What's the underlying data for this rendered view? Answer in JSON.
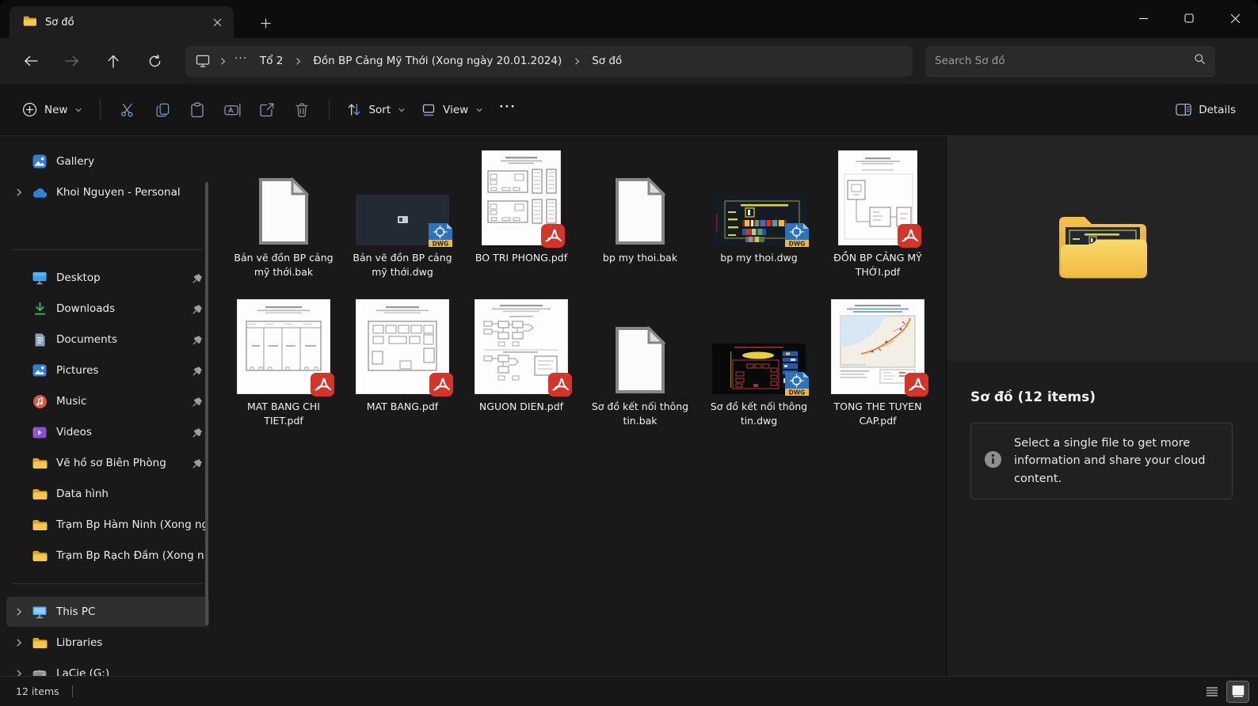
{
  "titlebar": {
    "tab_title": "Sơ đồ"
  },
  "navbar": {
    "breadcrumb": {
      "root_icon": "this-pc-monitor-icon",
      "overflow": "···",
      "segments": [
        "Tổ 2",
        "Đồn BP Cảng Mỹ Thới (Xong ngày 20.01.2024)",
        "Sơ đồ"
      ]
    },
    "search_placeholder": "Search Sơ đồ"
  },
  "toolbar": {
    "new_label": "New",
    "sort_label": "Sort",
    "view_label": "View",
    "more_label": "···",
    "details_label": "Details"
  },
  "sidebar": {
    "items": [
      {
        "label": "Gallery",
        "icon": "gallery"
      },
      {
        "label": "Khoi Nguyen - Personal",
        "icon": "onedrive",
        "chevron": true
      },
      {
        "gap": true
      },
      {
        "divider": true
      },
      {
        "label": "Desktop",
        "icon": "desktop",
        "pinned": true
      },
      {
        "label": "Downloads",
        "icon": "downloads",
        "pinned": true
      },
      {
        "label": "Documents",
        "icon": "documents",
        "pinned": true
      },
      {
        "label": "Pictures",
        "icon": "pictures",
        "pinned": true
      },
      {
        "label": "Music",
        "icon": "music",
        "pinned": true
      },
      {
        "label": "Videos",
        "icon": "videos",
        "pinned": true
      },
      {
        "label": "Vẽ hồ sơ Biên Phòng",
        "icon": "folder",
        "pinned": true
      },
      {
        "label": "Data hình",
        "icon": "folder"
      },
      {
        "label": "Trạm Bp Hàm Ninh (Xong ng",
        "icon": "folder"
      },
      {
        "label": "Trạm Bp Rạch Đầm (Xong n",
        "icon": "folder"
      },
      {
        "divider": true
      },
      {
        "label": "This PC",
        "icon": "thispc",
        "chevron": true,
        "selected": true
      },
      {
        "label": "Libraries",
        "icon": "folder",
        "chevron": true
      },
      {
        "label": "LaCie (G:)",
        "icon": "drive",
        "chevron": true
      }
    ]
  },
  "files": [
    {
      "name": "Bản vẽ đồn BP cảng mỹ thới.bak",
      "kind": "bak"
    },
    {
      "name": "Bản vẽ đồn BP cảng mỹ thới.dwg",
      "kind": "dwg-plain"
    },
    {
      "name": "BO TRI PHONG.pdf",
      "kind": "pdf-layout"
    },
    {
      "name": "bp my thoi.bak",
      "kind": "bak"
    },
    {
      "name": "bp my thoi.dwg",
      "kind": "dwg-strips"
    },
    {
      "name": "ĐỒN BP CẢNG MỸ THỚI.pdf",
      "kind": "pdf-schematic"
    },
    {
      "name": "MAT BANG CHI TIET.pdf",
      "kind": "pdf-plan-detail"
    },
    {
      "name": "MAT BANG.pdf",
      "kind": "pdf-plan"
    },
    {
      "name": "NGUON DIEN.pdf",
      "kind": "pdf-flow"
    },
    {
      "name": "Sơ đồ kết nối thông tin.bak",
      "kind": "bak"
    },
    {
      "name": "Sơ đồ kết nối thông tin.dwg",
      "kind": "dwg-dark"
    },
    {
      "name": "TONG THE TUYEN CAP.pdf",
      "kind": "pdf-map"
    }
  ],
  "badges": {
    "dwg_label": "DWG"
  },
  "details_panel": {
    "title": "Sơ đồ (12 items)",
    "info_text": "Select a single file to get more information and share your cloud content."
  },
  "statusbar": {
    "items_count": "12 items"
  },
  "colors": {
    "accent_blue": "#5b9bd5",
    "folder_yellow": "#f3c84b",
    "pdf_red": "#d3352b",
    "dwg_badge_blue": "#2e72b8",
    "dwg_badge_yellow": "#efb73e"
  }
}
